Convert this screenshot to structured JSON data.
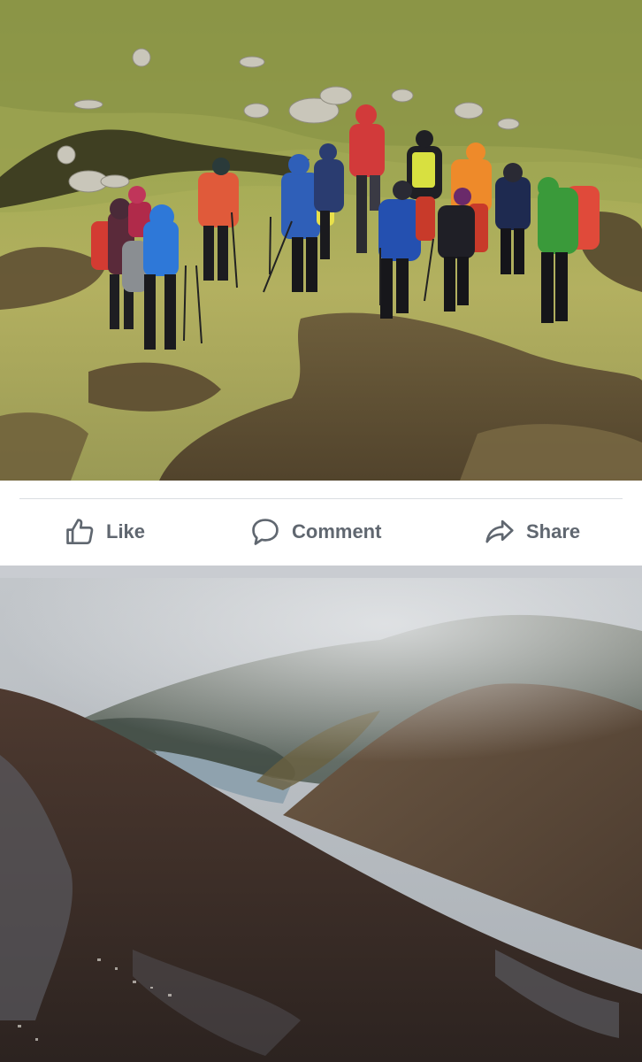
{
  "post_top": {
    "photo": {
      "subject": "group-of-hikers-on-hillside"
    }
  },
  "actions": {
    "like_label": "Like",
    "comment_label": "Comment",
    "share_label": "Share",
    "like_icon": "thumbs-up-icon",
    "comment_icon": "speech-bubble-icon",
    "share_icon": "share-arrow-icon",
    "label_color": "#606770"
  },
  "post_bottom": {
    "photo": {
      "subject": "misty-mountains-and-sea-inlet"
    }
  },
  "colors": {
    "feed_separator": "#c9ccd1",
    "divider": "#dadde1"
  }
}
